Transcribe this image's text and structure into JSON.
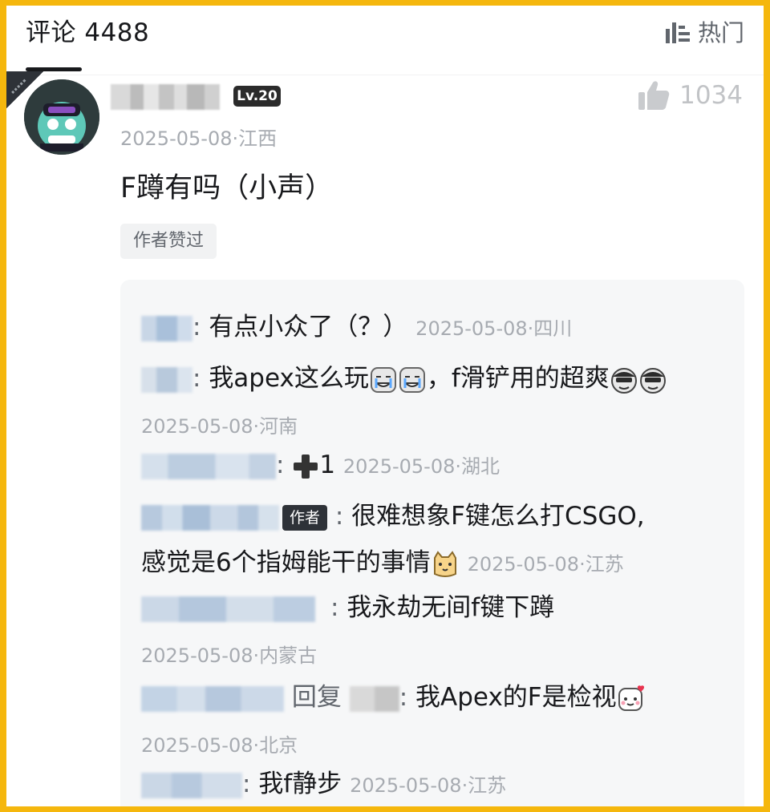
{
  "header": {
    "title": "评论 4488",
    "sort_label": "热门",
    "sort_icon": "sort-icon"
  },
  "comment": {
    "level": "Lv.20",
    "like_count": "1034",
    "meta": "2025-05-08·江西",
    "content": "F蹲有吗（小声）",
    "author_liked": "作者赞过"
  },
  "replies": [
    {
      "text": "有点小众了（？）",
      "time": "2025-05-08·四川"
    },
    {
      "text_a": "我apex这么玩",
      "text_b": "，f滑铲用的超爽",
      "time": "2025-05-08·河南"
    },
    {
      "text": "1",
      "time": "2025-05-08·湖北"
    },
    {
      "tag": "作者",
      "text_a": "很难想象F键怎么打CSGO,",
      "text_b": "感觉是6个指姆能干的事情",
      "time": "2025-05-08·江苏"
    },
    {
      "text": "我永劫无间f键下蹲",
      "time": "2025-05-08·内蒙古"
    },
    {
      "reply_word": "回复",
      "text": "我Apex的F是检视",
      "time": "2025-05-08·北京"
    },
    {
      "text": "我f静步",
      "time": "2025-05-08·江苏"
    }
  ]
}
